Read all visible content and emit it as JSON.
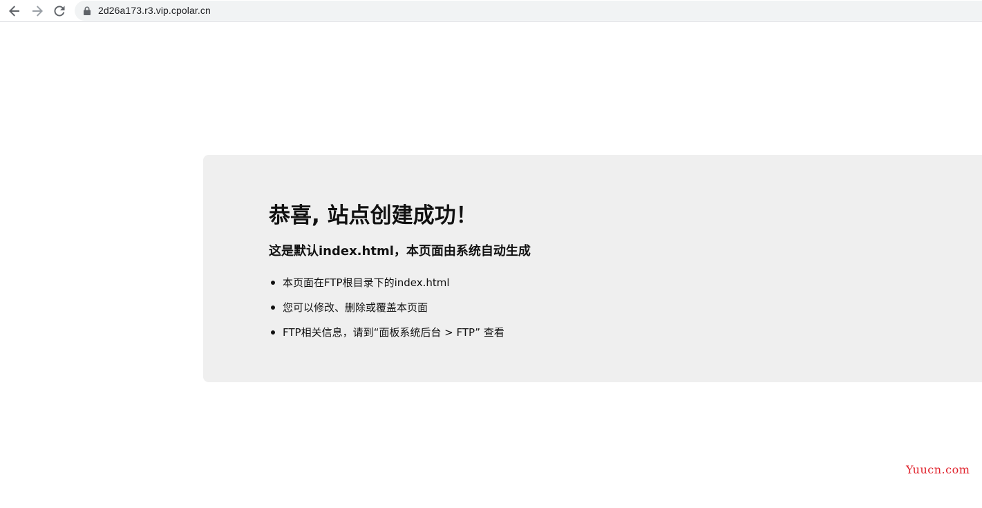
{
  "browser": {
    "url": "2d26a173.r3.vip.cpolar.cn",
    "icons": {
      "back": "arrow-left-icon",
      "forward": "arrow-right-icon",
      "reload": "reload-icon",
      "security": "lock-icon"
    }
  },
  "page": {
    "title": "恭喜, 站点创建成功！",
    "subtitle": "这是默认index.html，本页面由系统自动生成",
    "items": [
      "本页面在FTP根目录下的index.html",
      "您可以修改、删除或覆盖本页面",
      "FTP相关信息，请到“面板系统后台 > FTP” 查看"
    ],
    "card_color": "#efefef"
  },
  "watermark": {
    "text": "Yuucn.com",
    "color": "#e0202a"
  }
}
